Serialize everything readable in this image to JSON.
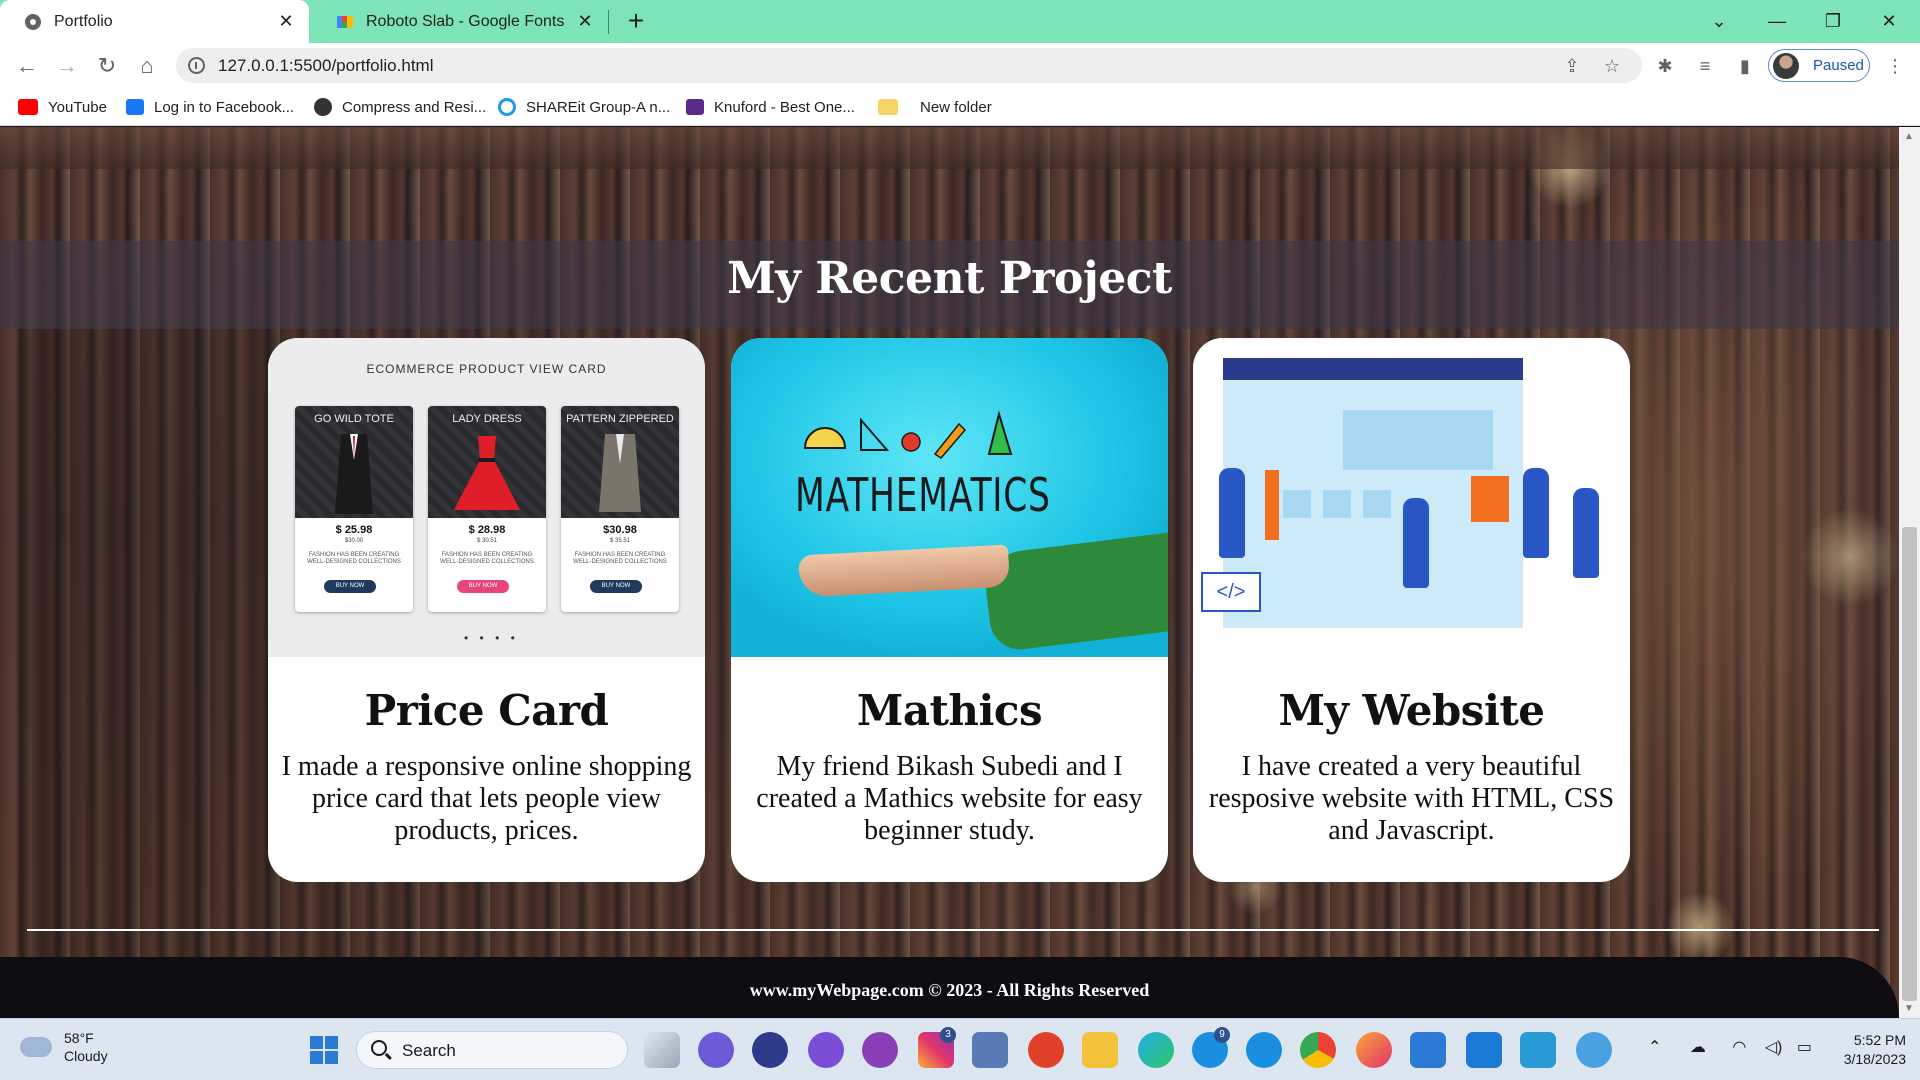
{
  "browser": {
    "tabs": [
      {
        "title": "Portfolio",
        "icon": "globe-icon",
        "active": true
      },
      {
        "title": "Roboto Slab - Google Fonts",
        "icon": "google-fonts-icon",
        "active": false
      }
    ],
    "url": "127.0.0.1:5500/portfolio.html",
    "profile_status": "Paused",
    "tabstrip_color": "#7de4b8",
    "bookmarks": [
      {
        "label": "YouTube",
        "icon": "youtube-icon",
        "color": "#ff0000"
      },
      {
        "label": "Log in to Facebook...",
        "icon": "facebook-icon",
        "color": "#1877f2"
      },
      {
        "label": "Compress and Resi...",
        "icon": "globe-icon",
        "color": "#333333"
      },
      {
        "label": "SHAREit Group-A n...",
        "icon": "shareit-icon",
        "color": "#1a9af0"
      },
      {
        "label": "Knuford - Best One...",
        "icon": "knuford-icon",
        "color": "#5a2a8a"
      },
      {
        "label": "New folder",
        "icon": "folder-icon",
        "color": "#f6d365"
      }
    ]
  },
  "page": {
    "section_title": "My Recent Project",
    "projects": [
      {
        "title": "Price Card",
        "description": "I made a responsive online shopping price card that lets people view products, prices.",
        "thumbnail": {
          "heading": "ECOMMERCE PRODUCT VIEW CARD",
          "items": [
            {
              "name": "GO WILD TOTE",
              "price": "$ 25.98",
              "old_price": "$30.00",
              "desc": "FASHION HAS BEEN CREATING WELL-DESIGNED COLLECTIONS",
              "button": "BUY NOW",
              "button_color": "#1f3a5c"
            },
            {
              "name": "LADY DRESS",
              "price": "$ 28.98",
              "old_price": "$ 30.51",
              "desc": "FASHION HAS BEEN CREATING WELL-DESIGNED COLLECTIONS",
              "button": "BUY NOW",
              "button_color": "#e8457a"
            },
            {
              "name": "PATTERN ZIPPERED",
              "price": "$30.98",
              "old_price": "$ 35.51",
              "desc": "FASHION HAS BEEN CREATING WELL-DESIGNED COLLECTIONS",
              "button": "BUY NOW",
              "button_color": "#1f3a5c"
            }
          ],
          "dots": "• • • •"
        }
      },
      {
        "title": "Mathics",
        "description": "My friend Bikash Subedi and I created a Mathics website for easy beginner study.",
        "thumbnail": {
          "word": "MATHEMATICS"
        }
      },
      {
        "title": "My Website",
        "description": "I have created a very beautiful resposive website with HTML, CSS and Javascript.",
        "thumbnail": {
          "code_glyph": "</>"
        }
      }
    ],
    "footer": "www.myWebpage.com © 2023 - All Rights Reserved"
  },
  "taskbar": {
    "weather_temp": "58°F",
    "weather_desc": "Cloudy",
    "search_label": "Search",
    "instagram_badge": "3",
    "skype_badge": "9",
    "time": "5:52 PM",
    "date": "3/18/2023"
  }
}
